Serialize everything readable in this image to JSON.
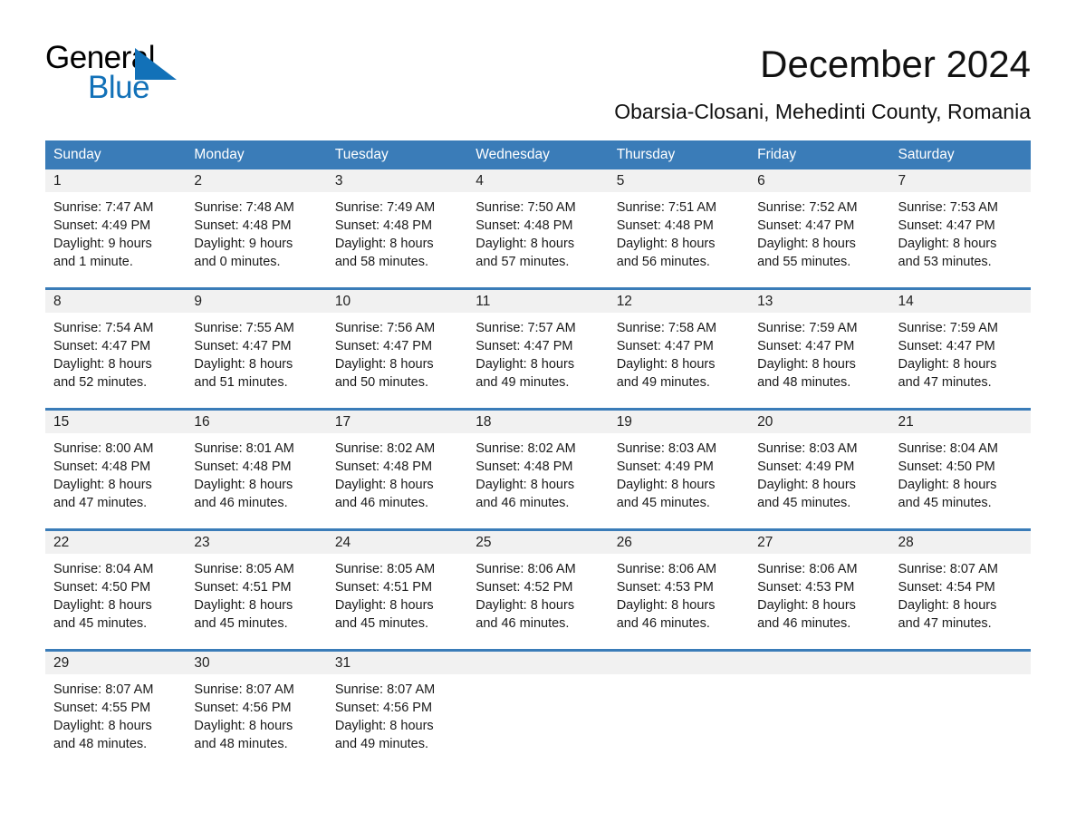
{
  "brand": {
    "name_dark": "General",
    "name_light": "Blue",
    "accent_color": "#1271b8"
  },
  "header": {
    "title": "December 2024",
    "subtitle": "Obarsia-Closani, Mehedinti County, Romania"
  },
  "calendar": {
    "header_bg": "#3a7cb8",
    "daynum_bg": "#f1f1f1",
    "weekdays": [
      "Sunday",
      "Monday",
      "Tuesday",
      "Wednesday",
      "Thursday",
      "Friday",
      "Saturday"
    ],
    "weeks": [
      [
        {
          "day": "1",
          "sunrise": "Sunrise: 7:47 AM",
          "sunset": "Sunset: 4:49 PM",
          "daylight1": "Daylight: 9 hours",
          "daylight2": "and 1 minute."
        },
        {
          "day": "2",
          "sunrise": "Sunrise: 7:48 AM",
          "sunset": "Sunset: 4:48 PM",
          "daylight1": "Daylight: 9 hours",
          "daylight2": "and 0 minutes."
        },
        {
          "day": "3",
          "sunrise": "Sunrise: 7:49 AM",
          "sunset": "Sunset: 4:48 PM",
          "daylight1": "Daylight: 8 hours",
          "daylight2": "and 58 minutes."
        },
        {
          "day": "4",
          "sunrise": "Sunrise: 7:50 AM",
          "sunset": "Sunset: 4:48 PM",
          "daylight1": "Daylight: 8 hours",
          "daylight2": "and 57 minutes."
        },
        {
          "day": "5",
          "sunrise": "Sunrise: 7:51 AM",
          "sunset": "Sunset: 4:48 PM",
          "daylight1": "Daylight: 8 hours",
          "daylight2": "and 56 minutes."
        },
        {
          "day": "6",
          "sunrise": "Sunrise: 7:52 AM",
          "sunset": "Sunset: 4:47 PM",
          "daylight1": "Daylight: 8 hours",
          "daylight2": "and 55 minutes."
        },
        {
          "day": "7",
          "sunrise": "Sunrise: 7:53 AM",
          "sunset": "Sunset: 4:47 PM",
          "daylight1": "Daylight: 8 hours",
          "daylight2": "and 53 minutes."
        }
      ],
      [
        {
          "day": "8",
          "sunrise": "Sunrise: 7:54 AM",
          "sunset": "Sunset: 4:47 PM",
          "daylight1": "Daylight: 8 hours",
          "daylight2": "and 52 minutes."
        },
        {
          "day": "9",
          "sunrise": "Sunrise: 7:55 AM",
          "sunset": "Sunset: 4:47 PM",
          "daylight1": "Daylight: 8 hours",
          "daylight2": "and 51 minutes."
        },
        {
          "day": "10",
          "sunrise": "Sunrise: 7:56 AM",
          "sunset": "Sunset: 4:47 PM",
          "daylight1": "Daylight: 8 hours",
          "daylight2": "and 50 minutes."
        },
        {
          "day": "11",
          "sunrise": "Sunrise: 7:57 AM",
          "sunset": "Sunset: 4:47 PM",
          "daylight1": "Daylight: 8 hours",
          "daylight2": "and 49 minutes."
        },
        {
          "day": "12",
          "sunrise": "Sunrise: 7:58 AM",
          "sunset": "Sunset: 4:47 PM",
          "daylight1": "Daylight: 8 hours",
          "daylight2": "and 49 minutes."
        },
        {
          "day": "13",
          "sunrise": "Sunrise: 7:59 AM",
          "sunset": "Sunset: 4:47 PM",
          "daylight1": "Daylight: 8 hours",
          "daylight2": "and 48 minutes."
        },
        {
          "day": "14",
          "sunrise": "Sunrise: 7:59 AM",
          "sunset": "Sunset: 4:47 PM",
          "daylight1": "Daylight: 8 hours",
          "daylight2": "and 47 minutes."
        }
      ],
      [
        {
          "day": "15",
          "sunrise": "Sunrise: 8:00 AM",
          "sunset": "Sunset: 4:48 PM",
          "daylight1": "Daylight: 8 hours",
          "daylight2": "and 47 minutes."
        },
        {
          "day": "16",
          "sunrise": "Sunrise: 8:01 AM",
          "sunset": "Sunset: 4:48 PM",
          "daylight1": "Daylight: 8 hours",
          "daylight2": "and 46 minutes."
        },
        {
          "day": "17",
          "sunrise": "Sunrise: 8:02 AM",
          "sunset": "Sunset: 4:48 PM",
          "daylight1": "Daylight: 8 hours",
          "daylight2": "and 46 minutes."
        },
        {
          "day": "18",
          "sunrise": "Sunrise: 8:02 AM",
          "sunset": "Sunset: 4:48 PM",
          "daylight1": "Daylight: 8 hours",
          "daylight2": "and 46 minutes."
        },
        {
          "day": "19",
          "sunrise": "Sunrise: 8:03 AM",
          "sunset": "Sunset: 4:49 PM",
          "daylight1": "Daylight: 8 hours",
          "daylight2": "and 45 minutes."
        },
        {
          "day": "20",
          "sunrise": "Sunrise: 8:03 AM",
          "sunset": "Sunset: 4:49 PM",
          "daylight1": "Daylight: 8 hours",
          "daylight2": "and 45 minutes."
        },
        {
          "day": "21",
          "sunrise": "Sunrise: 8:04 AM",
          "sunset": "Sunset: 4:50 PM",
          "daylight1": "Daylight: 8 hours",
          "daylight2": "and 45 minutes."
        }
      ],
      [
        {
          "day": "22",
          "sunrise": "Sunrise: 8:04 AM",
          "sunset": "Sunset: 4:50 PM",
          "daylight1": "Daylight: 8 hours",
          "daylight2": "and 45 minutes."
        },
        {
          "day": "23",
          "sunrise": "Sunrise: 8:05 AM",
          "sunset": "Sunset: 4:51 PM",
          "daylight1": "Daylight: 8 hours",
          "daylight2": "and 45 minutes."
        },
        {
          "day": "24",
          "sunrise": "Sunrise: 8:05 AM",
          "sunset": "Sunset: 4:51 PM",
          "daylight1": "Daylight: 8 hours",
          "daylight2": "and 45 minutes."
        },
        {
          "day": "25",
          "sunrise": "Sunrise: 8:06 AM",
          "sunset": "Sunset: 4:52 PM",
          "daylight1": "Daylight: 8 hours",
          "daylight2": "and 46 minutes."
        },
        {
          "day": "26",
          "sunrise": "Sunrise: 8:06 AM",
          "sunset": "Sunset: 4:53 PM",
          "daylight1": "Daylight: 8 hours",
          "daylight2": "and 46 minutes."
        },
        {
          "day": "27",
          "sunrise": "Sunrise: 8:06 AM",
          "sunset": "Sunset: 4:53 PM",
          "daylight1": "Daylight: 8 hours",
          "daylight2": "and 46 minutes."
        },
        {
          "day": "28",
          "sunrise": "Sunrise: 8:07 AM",
          "sunset": "Sunset: 4:54 PM",
          "daylight1": "Daylight: 8 hours",
          "daylight2": "and 47 minutes."
        }
      ],
      [
        {
          "day": "29",
          "sunrise": "Sunrise: 8:07 AM",
          "sunset": "Sunset: 4:55 PM",
          "daylight1": "Daylight: 8 hours",
          "daylight2": "and 48 minutes."
        },
        {
          "day": "30",
          "sunrise": "Sunrise: 8:07 AM",
          "sunset": "Sunset: 4:56 PM",
          "daylight1": "Daylight: 8 hours",
          "daylight2": "and 48 minutes."
        },
        {
          "day": "31",
          "sunrise": "Sunrise: 8:07 AM",
          "sunset": "Sunset: 4:56 PM",
          "daylight1": "Daylight: 8 hours",
          "daylight2": "and 49 minutes."
        },
        {
          "day": "",
          "sunrise": "",
          "sunset": "",
          "daylight1": "",
          "daylight2": ""
        },
        {
          "day": "",
          "sunrise": "",
          "sunset": "",
          "daylight1": "",
          "daylight2": ""
        },
        {
          "day": "",
          "sunrise": "",
          "sunset": "",
          "daylight1": "",
          "daylight2": ""
        },
        {
          "day": "",
          "sunrise": "",
          "sunset": "",
          "daylight1": "",
          "daylight2": ""
        }
      ]
    ]
  }
}
